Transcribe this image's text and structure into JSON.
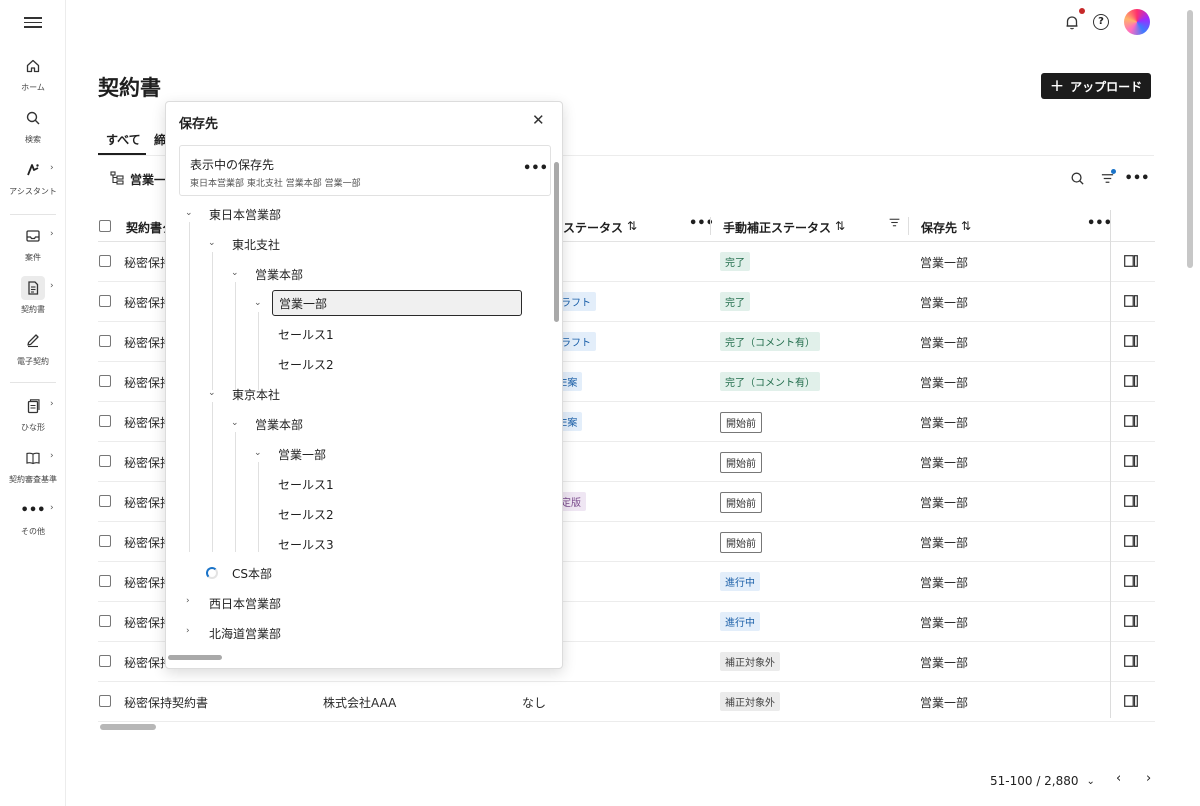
{
  "colors": {
    "primary_button_bg": "#1c1c1c",
    "badge_done_bg": "#e1f0ea",
    "badge_done_fg": "#1f6b4a",
    "badge_progress_bg": "#e3eefa",
    "badge_progress_fg": "#1a5fa8",
    "badge_excluded_bg": "#ebebeb",
    "notification_dot": "#c62828",
    "accent": "#1a73c8"
  },
  "rail": {
    "items": [
      {
        "label": "ホーム",
        "icon": "home-icon"
      },
      {
        "label": "検索",
        "icon": "search-icon"
      },
      {
        "label": "アシスタント",
        "icon": "assistant-icon"
      },
      {
        "label": "案件",
        "icon": "inbox-icon"
      },
      {
        "label": "契約書",
        "icon": "document-icon"
      },
      {
        "label": "電子契約",
        "icon": "pen-icon"
      },
      {
        "label": "ひな形",
        "icon": "template-icon"
      },
      {
        "label": "契約審査基準",
        "icon": "book-icon"
      },
      {
        "label": "その他",
        "icon": "more-icon"
      }
    ]
  },
  "header": {
    "title": "契約書",
    "upload_label": "アップロード"
  },
  "tabs": [
    "すべて",
    "締"
  ],
  "toolbar": {
    "folder_label": "営業一"
  },
  "table": {
    "headers": {
      "name": "契約書タ",
      "status": "ステータス",
      "manual_status": "手動補正ステータス",
      "save_location": "保存先"
    },
    "rows": [
      {
        "name": "秘密保持",
        "status": "",
        "manual": "完了",
        "manual_kind": "done",
        "location": "営業一部"
      },
      {
        "name": "秘密保持",
        "status": "ラフト",
        "manual": "完了",
        "manual_kind": "done",
        "location": "営業一部"
      },
      {
        "name": "秘密保持",
        "status": "ラフト",
        "manual": "完了（コメント有）",
        "manual_kind": "done",
        "location": "営業一部"
      },
      {
        "name": "秘密保持",
        "status": "E案",
        "manual": "完了（コメント有）",
        "manual_kind": "done",
        "location": "営業一部"
      },
      {
        "name": "秘密保持",
        "status": "E案",
        "manual": "開始前",
        "manual_kind": "outline",
        "location": "営業一部"
      },
      {
        "name": "秘密保持",
        "status": "",
        "manual": "開始前",
        "manual_kind": "outline",
        "location": "営業一部"
      },
      {
        "name": "秘密保持",
        "status": "定版",
        "manual": "開始前",
        "manual_kind": "outline",
        "location": "営業一部"
      },
      {
        "name": "秘密保持",
        "status": "",
        "manual": "開始前",
        "manual_kind": "outline",
        "location": "営業一部"
      },
      {
        "name": "秘密保持",
        "status": "",
        "manual": "進行中",
        "manual_kind": "progress",
        "location": "営業一部"
      },
      {
        "name": "秘密保持",
        "status": "",
        "manual": "進行中",
        "manual_kind": "progress",
        "location": "営業一部"
      },
      {
        "name": "秘密保持",
        "status": "",
        "manual": "補正対象外",
        "manual_kind": "excluded",
        "location": "営業一部"
      },
      {
        "name": "秘密保持契約書",
        "company": "株式会社AAA",
        "status": "なし",
        "manual": "補正対象外",
        "manual_kind": "excluded",
        "location": "営業一部"
      }
    ]
  },
  "pagination": {
    "range": "51-100 / 2,880"
  },
  "popover": {
    "title": "保存先",
    "current_label": "表示中の保存先",
    "current_path": "東日本営業部 東北支社 営業本部 営業一部",
    "tree": [
      "東日本営業部",
      "東北支社",
      "営業本部",
      "営業一部",
      "セールス1",
      "セールス2",
      "東京本社",
      "営業本部",
      "営業一部",
      "セールス1",
      "セールス2",
      "セールス3",
      "CS本部",
      "西日本営業部",
      "北海道営業部"
    ]
  }
}
